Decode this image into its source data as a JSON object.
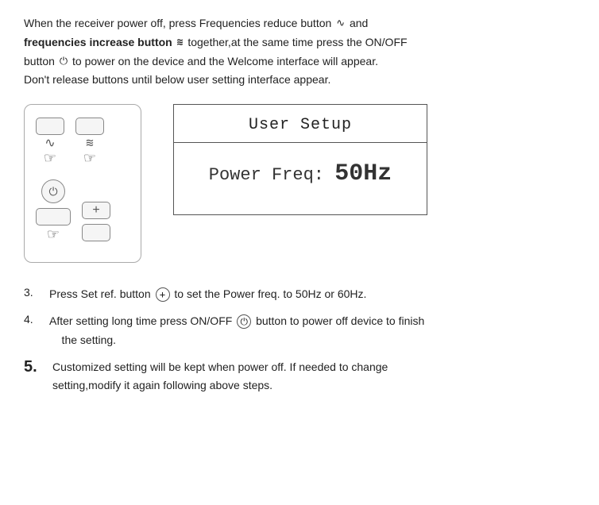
{
  "intro": {
    "line1": "When  the  receiver  power  off,  press  Frequencies  reduce  button",
    "freq_reduce_icon": "∿",
    "and": "and",
    "line2_bold": "frequencies  increase  button",
    "freq_increase_icon": "≋",
    "line2b": "together,at  the  same  time  press  the  ON/OFF",
    "line3": "button",
    "power_icon": "⏻",
    "line3b": "to  power  on  the  device  and  the  Welcome  interface  will  appear.",
    "line4": "Don't  release  buttons  until  below  user  setting  interface  appear."
  },
  "setup_box": {
    "title": "User Setup",
    "body_label": "Power Freq:",
    "body_value": "50Hz"
  },
  "steps": [
    {
      "num": "3.",
      "large": false,
      "text": "Press Set ref. button",
      "icon": "+",
      "text2": "to set the Power freq. to 50Hz or 60Hz."
    },
    {
      "num": "4.",
      "large": false,
      "text": "After setting long time press ON/OFF",
      "icon": "⏻",
      "text2": "button to power off device to finish the setting."
    },
    {
      "num": "5.",
      "large": true,
      "text": "Customized  setting  will  be  kept  when  power  off.  If  needed  to  change setting,modify it again following above steps."
    }
  ]
}
